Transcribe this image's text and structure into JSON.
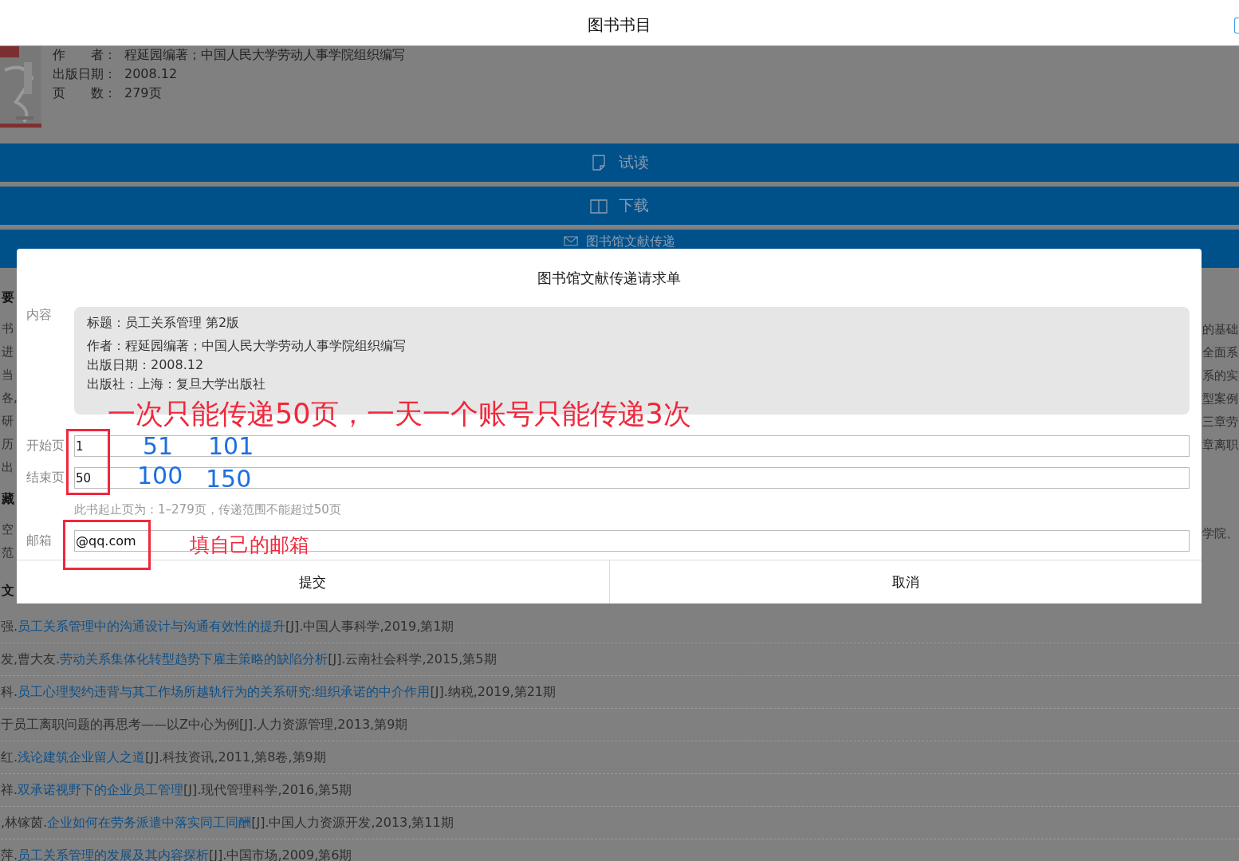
{
  "nav": {
    "title": "图书书目"
  },
  "book": {
    "lines": [
      {
        "label": "作　　者：",
        "value": "程延园编著；中国人民大学劳动人事学院组织编写"
      },
      {
        "label": "出版日期：",
        "value": "2008.12"
      },
      {
        "label": "页　　数：",
        "value": "279页"
      }
    ]
  },
  "actions": [
    {
      "kind": "read",
      "label": "试读"
    },
    {
      "kind": "download",
      "label": "下载"
    },
    {
      "kind": "mail",
      "label": "图书馆文献传递"
    }
  ],
  "left_fragments": [
    {
      "kind": "heading",
      "text": "要"
    },
    {
      "kind": "text",
      "text": "书"
    },
    {
      "kind": "text",
      "text": "进"
    },
    {
      "kind": "text",
      "text": "当"
    },
    {
      "kind": "text",
      "text": "各,"
    },
    {
      "kind": "text",
      "text": "研"
    },
    {
      "kind": "text",
      "text": "历"
    },
    {
      "kind": "text",
      "text": "出"
    },
    {
      "kind": "heading",
      "text": "藏"
    },
    {
      "kind": "text",
      "text": "空"
    },
    {
      "kind": "text",
      "text": "范"
    },
    {
      "kind": "heading",
      "text": "文"
    }
  ],
  "right_fragments": [
    "的基础",
    "全面系",
    "系的实",
    "型案例",
    "三章劳",
    "章离职",
    "学院、"
  ],
  "references": [
    {
      "prefix": "强.",
      "title": "员工关系管理中的沟通设计与沟通有效性的提升",
      "suffix": "[J].中国人事科学,2019,第1期"
    },
    {
      "prefix": "发,曹大友.",
      "title": "劳动关系集体化转型趋势下雇主策略的缺陷分析",
      "suffix": "[J].云南社会科学,2015,第5期"
    },
    {
      "prefix": "科.",
      "title": "员工心理契约违背与其工作场所越轨行为的关系研究:组织承诺的中介作用",
      "suffix": "[J].纳税,2019,第21期"
    },
    {
      "prefix": "于员工离职问题的再思考——以Z中心为例[J].人力资源管理,2013,第9期"
    },
    {
      "prefix": "红.",
      "title": "浅论建筑企业留人之道",
      "suffix": "[J].科技资讯,2011,第8卷,第9期"
    },
    {
      "prefix": "祥.",
      "title": "双承诺视野下的企业员工管理",
      "suffix": "[J].现代管理科学,2016,第5期"
    },
    {
      "prefix": ",林镓茵.",
      "title": "企业如何在劳务派遣中落实同工同酬",
      "suffix": "[J].中国人力资源开发,2013,第11期"
    },
    {
      "prefix": "萍.",
      "title": "员工关系管理的发展及其内容探析",
      "suffix": "[J].中国市场,2009,第6期"
    }
  ],
  "dialog": {
    "title": "图书馆文献传递请求单",
    "content_label": "内容",
    "content_lines": [
      "标题：员工关系管理 第2版",
      "作者：程延园编著；中国人民大学劳动人事学院组织编写",
      "出版日期：2008.12",
      "出版社：上海：复旦大学出版社"
    ],
    "fields": [
      {
        "label": "开始页",
        "value": "1"
      },
      {
        "label": "结束页",
        "value": "50"
      }
    ],
    "hint": "此书起止页为：1–279页，传递范围不能超过50页",
    "email": {
      "label": "邮箱",
      "value": "@qq.com"
    },
    "buttons": [
      "提交",
      "取消"
    ]
  },
  "annotations": {
    "note": "一次只能传递50页，一天一个账号只能传递3次",
    "start_pages": [
      "51",
      "101"
    ],
    "end_pages": [
      "100",
      "150"
    ],
    "email_note": "填自己的邮箱"
  }
}
